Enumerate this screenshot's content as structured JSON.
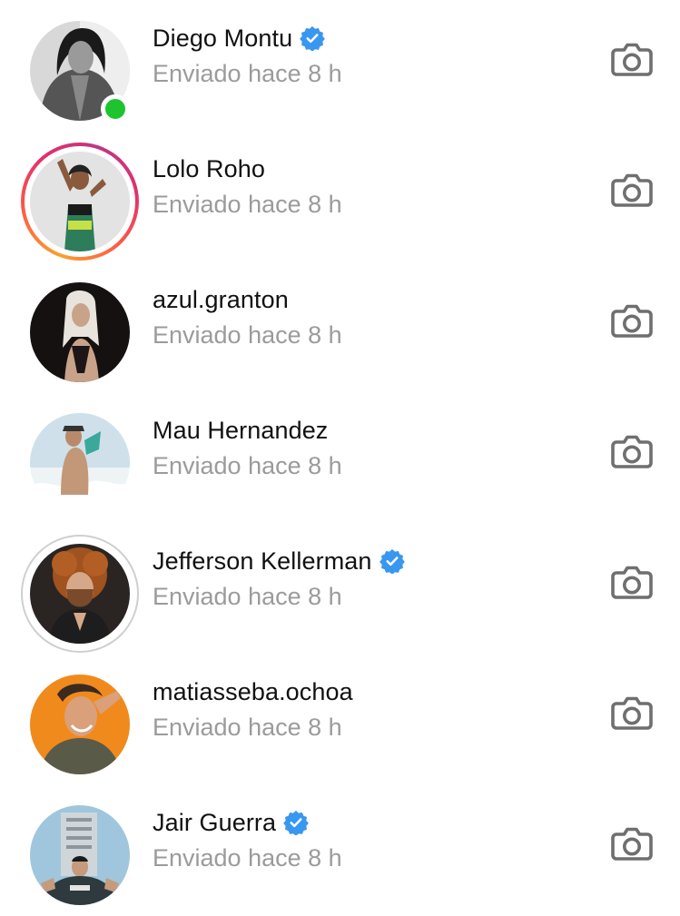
{
  "colors": {
    "name_text": "#111111",
    "sub_text": "#9b9b9b",
    "verified_blue": "#3897f0",
    "online_green": "#1ec42e",
    "icon_gray": "#6f6f6f"
  },
  "icons": {
    "camera": "camera-icon",
    "verified": "verified-badge-icon"
  },
  "threads": [
    {
      "name": "Diego Montu",
      "verified": true,
      "status": "Enviado hace 8 h",
      "online": true,
      "story_ring": "none"
    },
    {
      "name": "Lolo Roho",
      "verified": false,
      "status": "Enviado hace 8 h",
      "online": false,
      "story_ring": "unseen"
    },
    {
      "name": "azul.granton",
      "verified": false,
      "status": "Enviado hace 8 h",
      "online": false,
      "story_ring": "none"
    },
    {
      "name": "Mau Hernandez",
      "verified": false,
      "status": "Enviado hace 8 h",
      "online": false,
      "story_ring": "none"
    },
    {
      "name": "Jefferson Kellerman",
      "verified": true,
      "status": "Enviado hace 8 h",
      "online": false,
      "story_ring": "seen"
    },
    {
      "name": "matiasseba.ochoa",
      "verified": false,
      "status": "Enviado hace 8 h",
      "online": false,
      "story_ring": "none"
    },
    {
      "name": "Jair Guerra",
      "verified": true,
      "status": "Enviado hace 8 h",
      "online": false,
      "story_ring": "none"
    }
  ]
}
